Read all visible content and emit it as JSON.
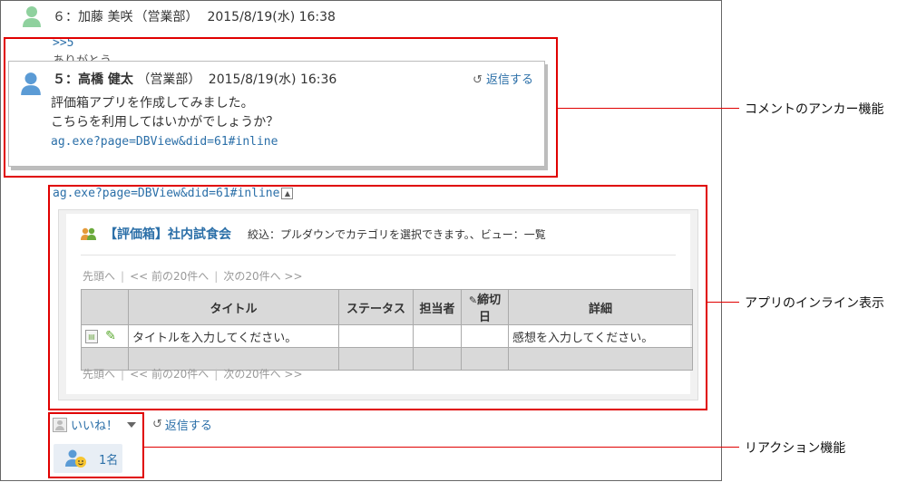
{
  "comment": {
    "number_name": "６：加藤 美咲",
    "dept": "（営業部）",
    "datetime": "2015/8/19(水) 16:38",
    "anchor": ">>5",
    "ghost_line1": "ありがとう",
    "ghost_line2": "こちらを利用してはいかがでしょうか？",
    "app_link": "ag.exe?page=DBView&did=61#inline"
  },
  "popup": {
    "number_name": "５：高橋 健太",
    "dept": "（営業部）",
    "datetime": "2015/8/19(水) 16:36",
    "reply_label": "返信する",
    "body_line1": "評価箱アプリを作成してみました。",
    "body_line2": "こちらを利用してはいかがでしょうか？",
    "link": "ag.exe?page=DBView&did=61#inline"
  },
  "app": {
    "title": "【評価箱】社内試食会",
    "filter": "絞込：プルダウンでカテゴリを選択できます。、ビュー：一覧",
    "pager": {
      "first": "先頭へ",
      "prev": "<< 前の20件へ",
      "next": "次の20件へ >>"
    },
    "columns": [
      "",
      "タイトル",
      "ステータス",
      "担当者",
      "締切日",
      "詳細"
    ],
    "row": {
      "title": "タイトルを入力してください。",
      "detail": "感想を入力してください。"
    }
  },
  "reactions": {
    "like_label": "いいね！",
    "reply_label": "返信する",
    "count": "1名"
  },
  "callouts": {
    "anchor": "コメントのアンカー機能",
    "inline": "アプリのインライン表示",
    "reaction": "リアクション機能"
  },
  "colors": {
    "highlight": "#e00000",
    "link": "#2b6fa8"
  }
}
